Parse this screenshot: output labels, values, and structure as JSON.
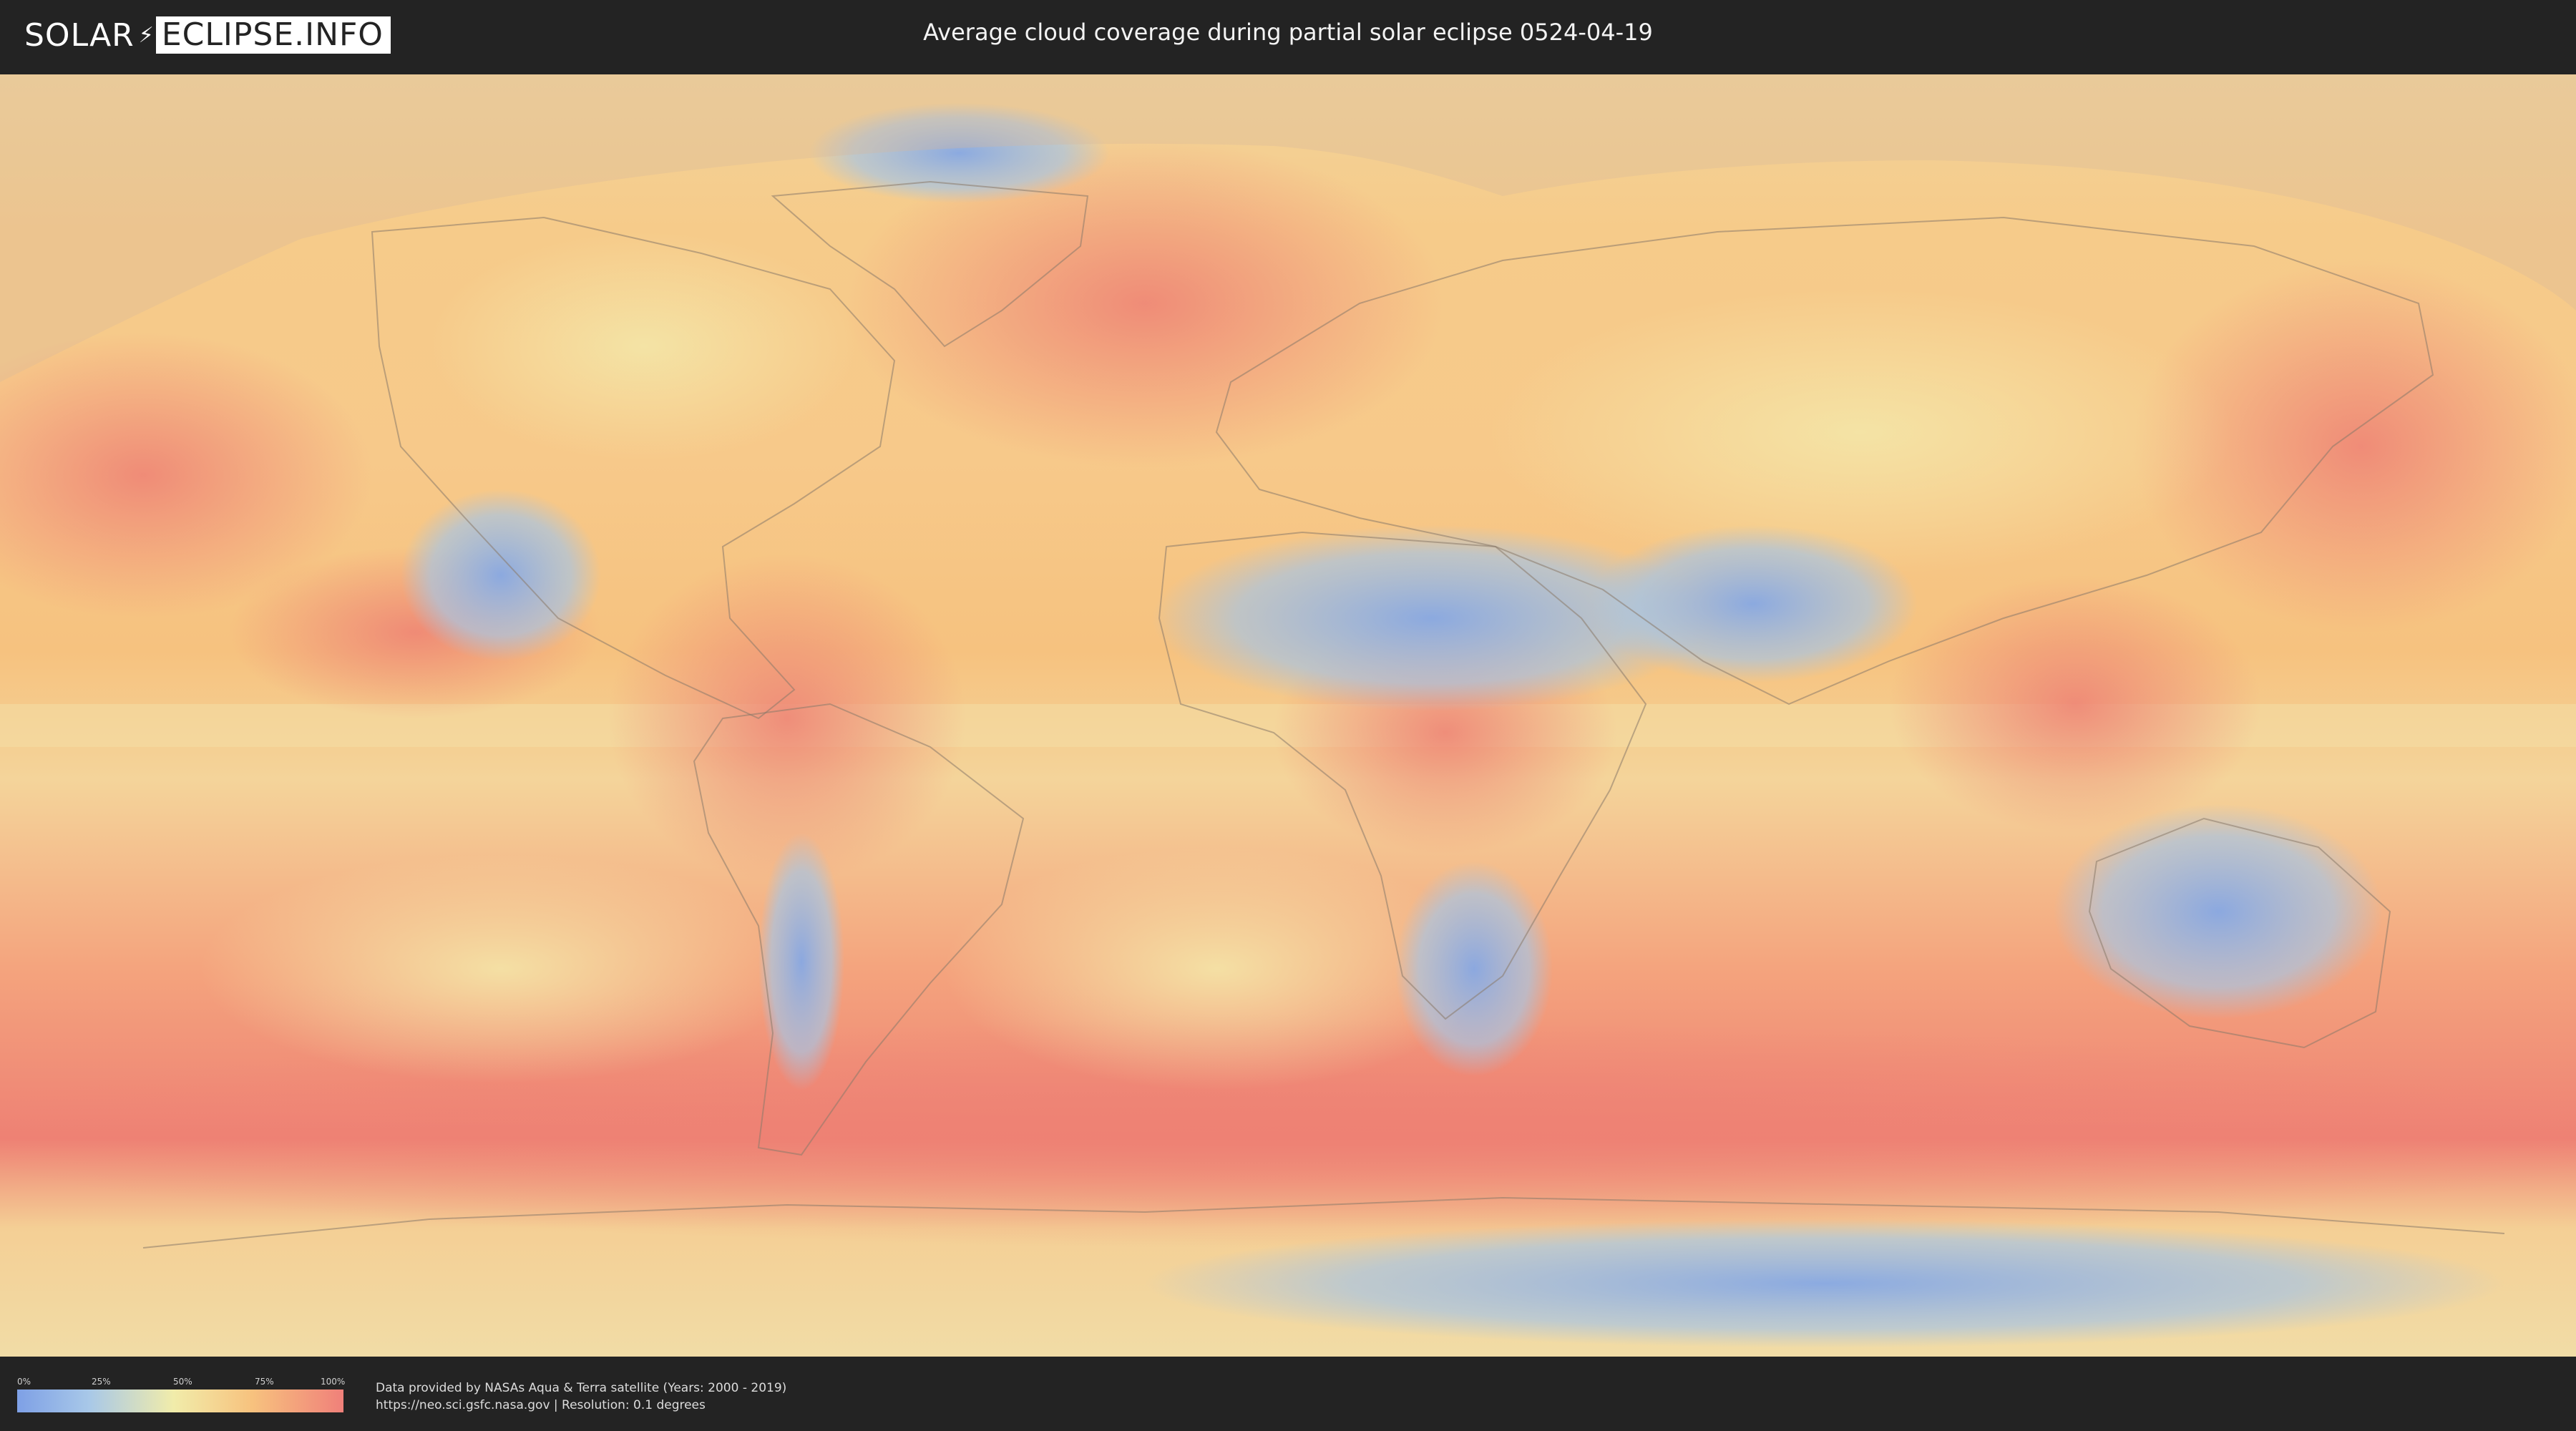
{
  "header": {
    "logo_left": "SOLAR",
    "logo_right": "ECLIPSE.INFO",
    "title": "Average cloud coverage during partial solar eclipse 0524-04-19"
  },
  "legend": {
    "ticks": [
      "0%",
      "25%",
      "50%",
      "75%",
      "100%"
    ],
    "colors": [
      "#7ea0e6",
      "#f1ecaa",
      "#f0807a"
    ]
  },
  "footer": {
    "credit_line1": "Data provided by NASAs Aqua & Terra satellite (Years: 2000 - 2019)",
    "credit_line2": "https://neo.sci.gsfc.nasa.gov | Resolution: 0.1 degrees"
  },
  "map": {
    "ocean_color": "#f6c27f",
    "cloudy_color": "#ee8174",
    "clear_color": "#86a8e4",
    "pale_color": "#f4e6a8"
  }
}
